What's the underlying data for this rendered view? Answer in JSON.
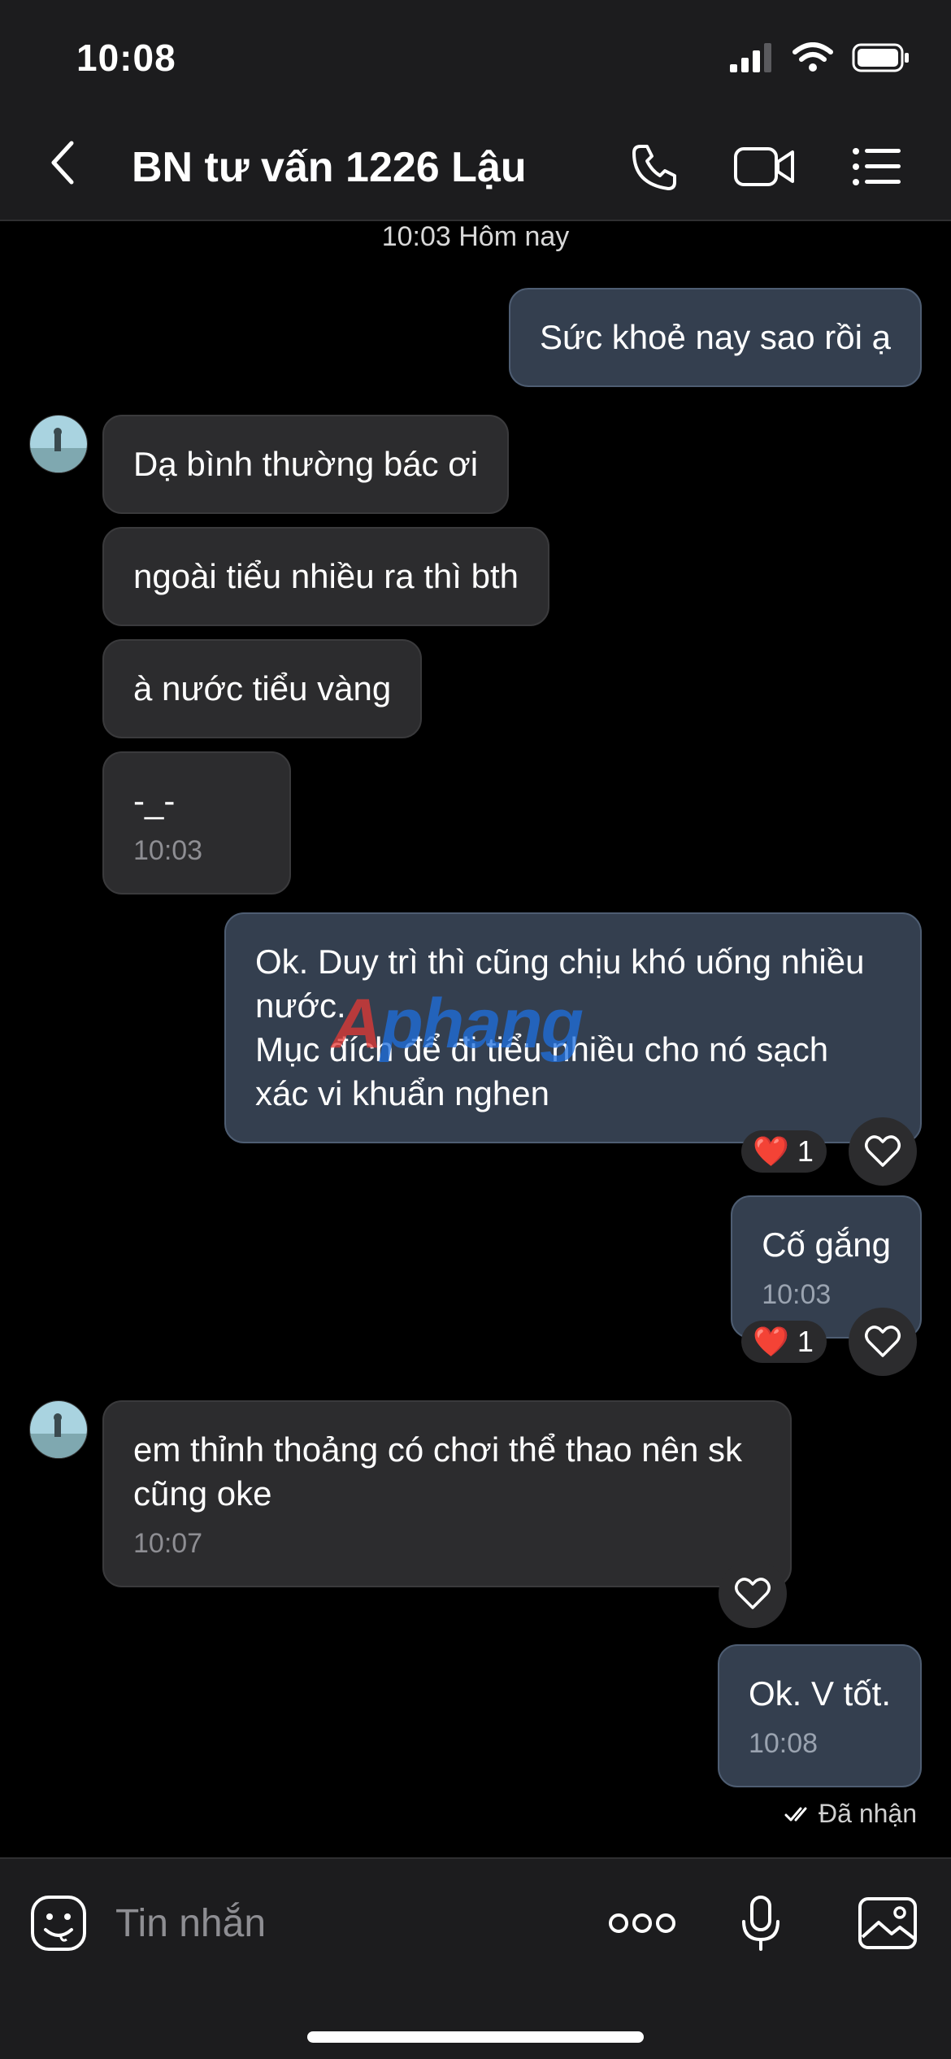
{
  "status_bar": {
    "time": "10:08"
  },
  "header": {
    "back_icon": "chevron-left-icon",
    "title": "BN tư vấn 1226 Lậu",
    "actions": [
      "phone-icon",
      "video-icon",
      "list-icon"
    ]
  },
  "chat": {
    "date_separator": "10:03 Hôm nay",
    "messages": [
      {
        "dir": "out",
        "text": "Sức khoẻ nay sao rồi ạ"
      },
      {
        "dir": "in",
        "text": "Dạ bình thường bác ơi"
      },
      {
        "dir": "in",
        "text": "ngoài tiểu nhiều ra thì bth"
      },
      {
        "dir": "in",
        "text": "à nước tiểu vàng"
      },
      {
        "dir": "in",
        "text": "-_-",
        "time": "10:03"
      },
      {
        "dir": "out",
        "text": "Ok. Duy trì thì cũng chịu khó uống nhiều nước.\nMục đích để đi tiểu nhiều cho nó sạch xác vi khuẩn nghen",
        "reaction": {
          "emoji": "❤️",
          "count": "1"
        }
      },
      {
        "dir": "out",
        "text": "Cố gắng",
        "time": "10:03",
        "reaction": {
          "emoji": "❤️",
          "count": "1"
        }
      },
      {
        "dir": "in",
        "text": "em thỉnh thoảng có chơi thể thao nên sk cũng oke",
        "time": "10:07"
      },
      {
        "dir": "out",
        "text": "Ok. V tốt.",
        "time": "10:08"
      }
    ],
    "receipt": "Đã nhận",
    "watermark": {
      "part1": "A",
      "part2": "phang"
    }
  },
  "input_bar": {
    "placeholder": "Tin nhắn",
    "icons": [
      "sticker-icon",
      "more-icon",
      "microphone-icon",
      "image-icon"
    ]
  },
  "colors": {
    "background": "#000000",
    "incoming_bubble": "#2c2c2e",
    "outgoing_bubble": "#343f4f",
    "heart": "#e0245e"
  }
}
